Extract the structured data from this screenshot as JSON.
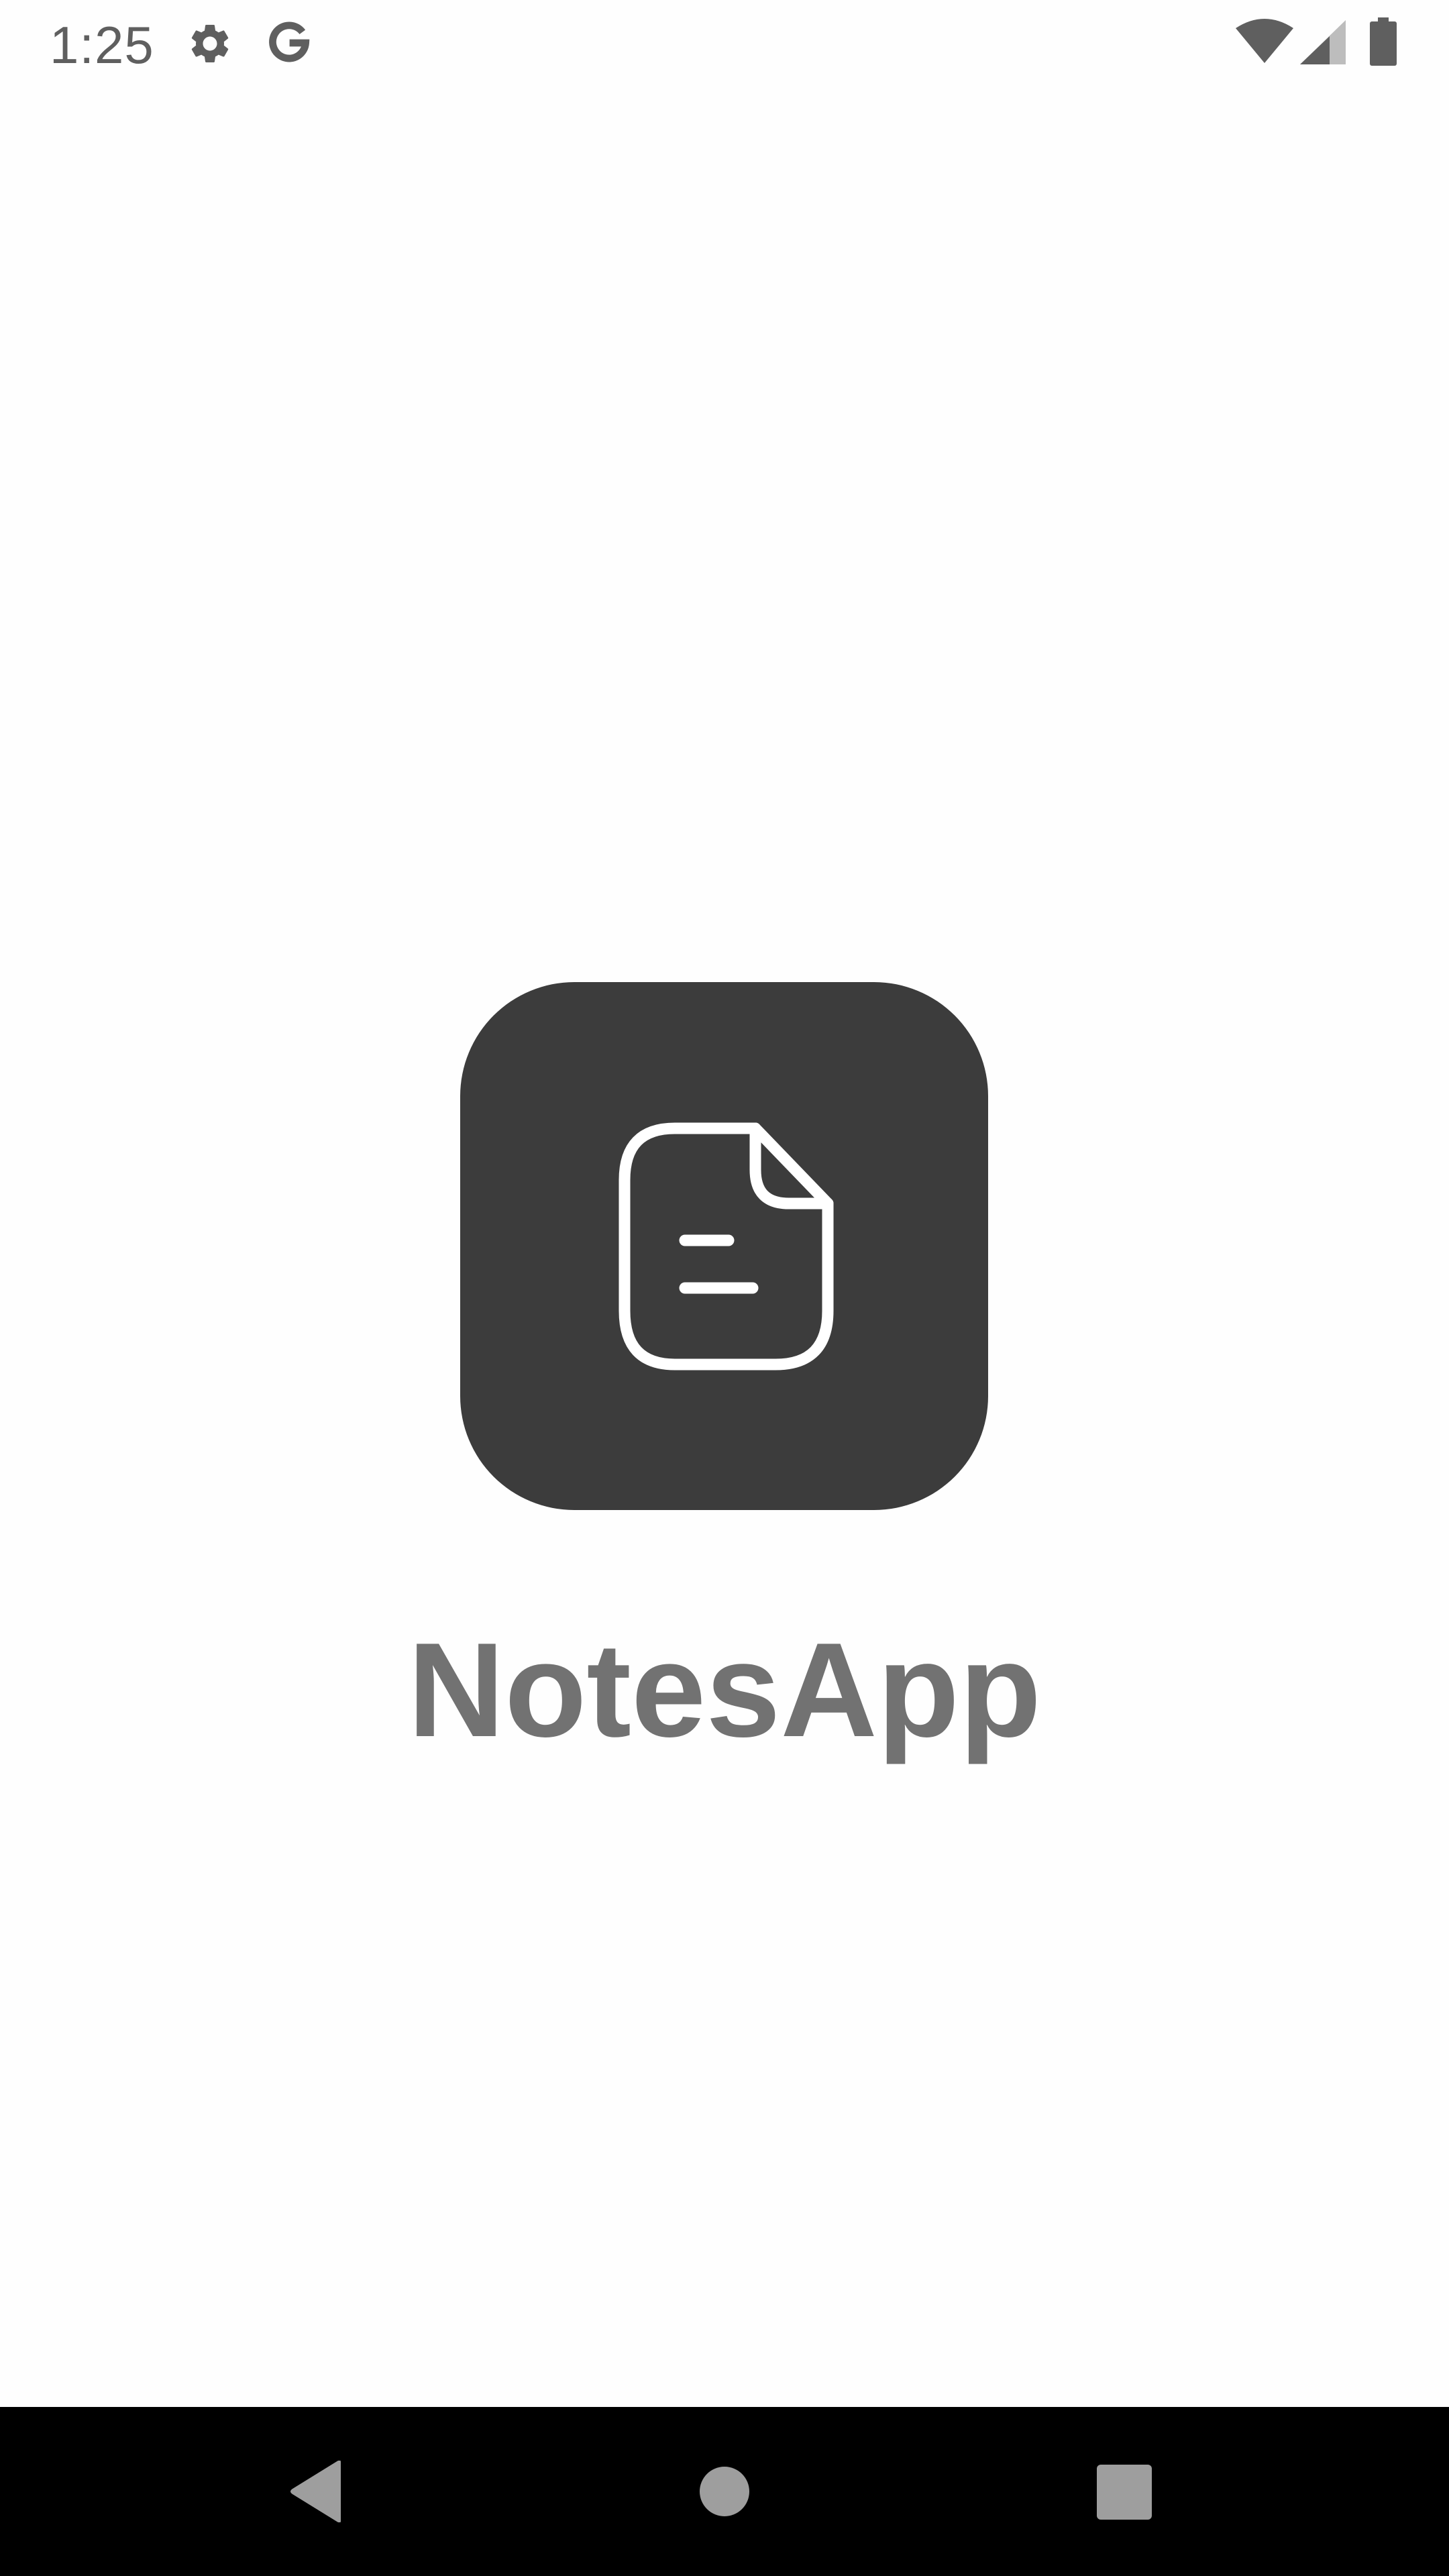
{
  "status_bar": {
    "time": "1:25",
    "icons": [
      "gear-icon",
      "google-g-icon",
      "wifi-icon",
      "cellular-signal-icon",
      "battery-icon"
    ]
  },
  "splash": {
    "app_name": "NotesApp",
    "logo_icon": "document-note-icon",
    "colors": {
      "background": "#fefefe",
      "logo_tile": "#3c3c3c",
      "app_name_text": "#727272"
    }
  },
  "nav_bar": {
    "buttons": [
      "back",
      "home",
      "recents"
    ]
  }
}
